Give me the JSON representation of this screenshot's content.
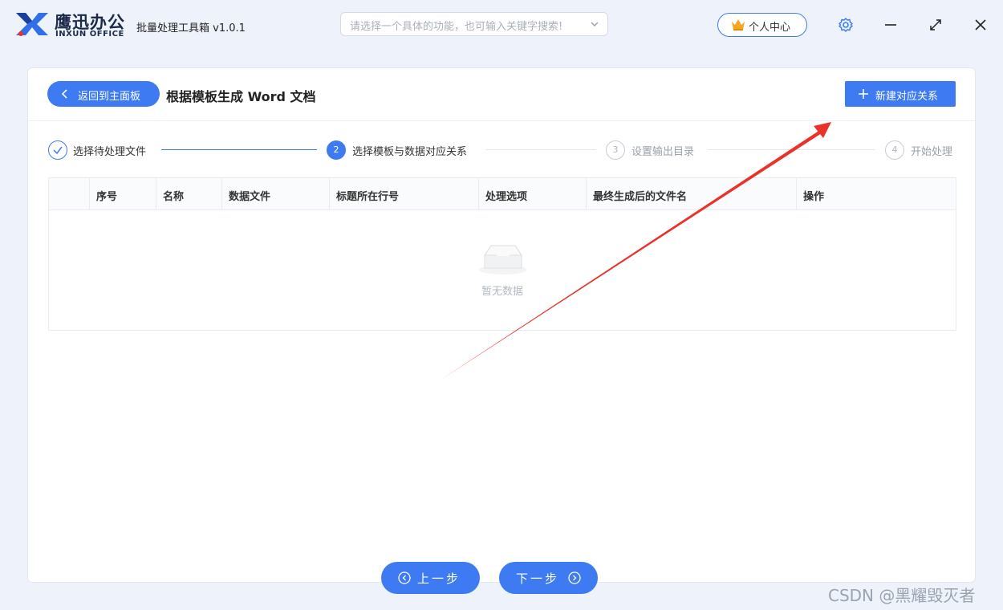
{
  "app": {
    "logo_cn": "鹰迅办公",
    "logo_en": "INXUN OFFICE",
    "name": "批量处理工具箱 v1.0.1"
  },
  "search": {
    "placeholder": "请选择一个具体的功能，也可输入关键字搜索!"
  },
  "header": {
    "user_center": "个人中心"
  },
  "page": {
    "back_label": "返回到主面板",
    "title": "根据模板生成 Word 文档",
    "new_button": "新建对应关系"
  },
  "steps": [
    {
      "num": "✓",
      "label": "选择待处理文件",
      "state": "done"
    },
    {
      "num": "2",
      "label": "选择模板与数据对应关系",
      "state": "active"
    },
    {
      "num": "3",
      "label": "设置输出目录",
      "state": "pending"
    },
    {
      "num": "4",
      "label": "开始处理",
      "state": "pending"
    }
  ],
  "table": {
    "columns": [
      "序号",
      "名称",
      "数据文件",
      "标题所在行号",
      "处理选项",
      "最终生成后的文件名",
      "操作"
    ],
    "empty_text": "暂无数据"
  },
  "footer": {
    "prev": "上一步",
    "next": "下一步"
  },
  "watermark": "CSDN @黑耀毁灭者",
  "colors": {
    "accent": "#3e7bf2",
    "arrow": "#e8322a",
    "background": "#eef3fb"
  }
}
